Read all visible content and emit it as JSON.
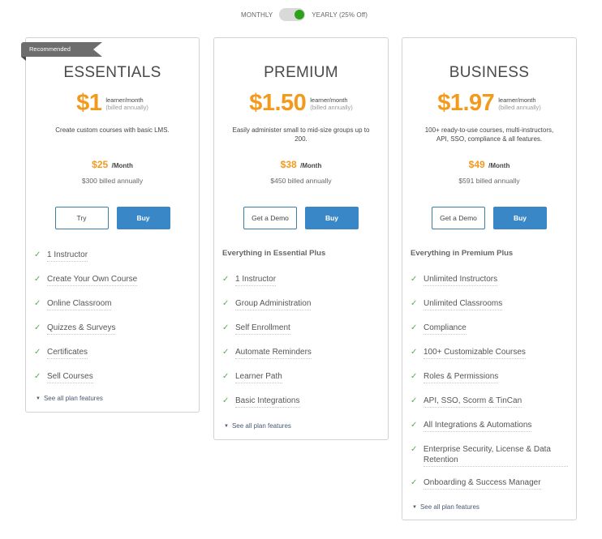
{
  "billing_toggle": {
    "monthly_label": "MONTHLY",
    "yearly_label": "YEARLY (25% Off)",
    "selected": "yearly",
    "knob_color": "#2ea11c"
  },
  "colors": {
    "price_accent": "#f39a1d",
    "buy_button": "#3a87c8",
    "check": "#5aaa55"
  },
  "plans": [
    {
      "ribbon": "Recommended",
      "name": "ESSENTIALS",
      "price": "$1",
      "unit": "learner/month",
      "billing_note": "(billed annually)",
      "description": "Create custom courses with basic LMS.",
      "monthly_amount": "$25",
      "monthly_suffix": "/Month",
      "annual_note": "$300 billed annually",
      "secondary_button": "Try",
      "primary_button": "Buy",
      "features_heading": "",
      "features": [
        "1 Instructor",
        "Create Your Own Course",
        "Online Classroom",
        "Quizzes & Surveys",
        "Certificates",
        "Sell Courses"
      ],
      "see_all": "See all plan features"
    },
    {
      "name": "PREMIUM",
      "price": "$1.50",
      "unit": "learner/month",
      "billing_note": "(billed annually)",
      "description": "Easily administer small to mid-size groups up to 200.",
      "monthly_amount": "$38",
      "monthly_suffix": "/Month",
      "annual_note": "$450 billed annually",
      "secondary_button": "Get a Demo",
      "primary_button": "Buy",
      "features_heading": "Everything in Essential Plus",
      "features": [
        "1 Instructor",
        "Group Administration",
        "Self Enrollment",
        "Automate Reminders",
        "Learner Path",
        "Basic Integrations"
      ],
      "see_all": "See all plan features"
    },
    {
      "name": "BUSINESS",
      "price": "$1.97",
      "unit": "learner/month",
      "billing_note": "(billed annually)",
      "description": "100+ ready-to-use courses, multi-instructors, API, SSO, compliance & all features.",
      "monthly_amount": "$49",
      "monthly_suffix": "/Month",
      "annual_note": "$591 billed annually",
      "secondary_button": "Get a Demo",
      "primary_button": "Buy",
      "features_heading": "Everything in Premium Plus",
      "features": [
        "Unlimited Instructors",
        "Unlimited Classrooms",
        "Compliance",
        "100+ Customizable Courses",
        "Roles & Permissions",
        "API, SSO, Scorm & TinCan",
        "All Integrations & Automations",
        "Enterprise Security, License & Data Retention",
        "Onboarding & Success Manager"
      ],
      "see_all": "See all plan features"
    }
  ]
}
